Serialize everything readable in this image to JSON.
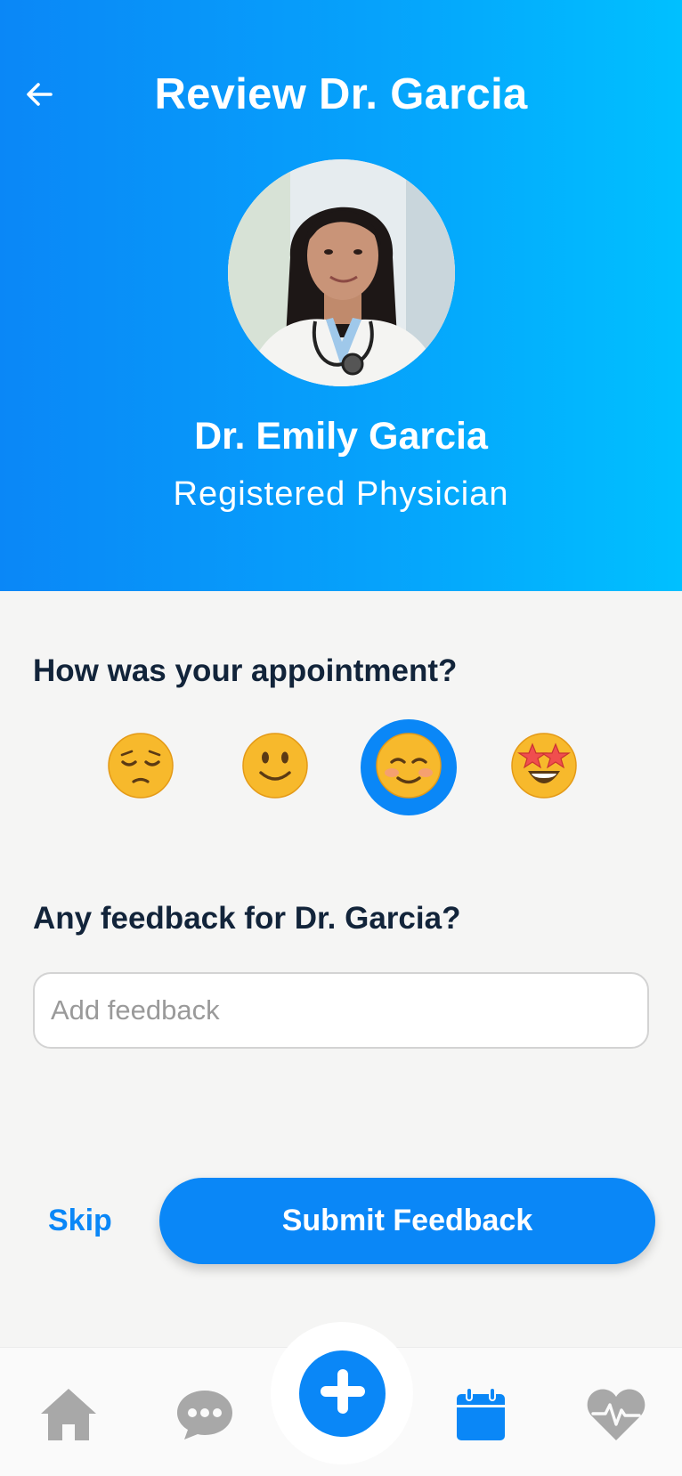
{
  "header": {
    "title": "Review Dr. Garcia",
    "back_icon": "arrow-left-icon"
  },
  "doctor": {
    "name": "Dr. Emily Garcia",
    "role": "Registered Physician"
  },
  "rating": {
    "question": "How was your appointment?",
    "options": [
      {
        "emoji": "😔",
        "icon": "pensive-face-icon",
        "selected": false
      },
      {
        "emoji": "🙂",
        "icon": "slightly-smiling-face-icon",
        "selected": false
      },
      {
        "emoji": "☺️",
        "icon": "smiling-face-icon",
        "selected": true
      },
      {
        "emoji": "🤩",
        "icon": "star-struck-face-icon",
        "selected": false
      }
    ]
  },
  "feedback": {
    "question": "Any feedback for Dr. Garcia?",
    "placeholder": "Add feedback",
    "value": ""
  },
  "actions": {
    "skip_label": "Skip",
    "submit_label": "Submit Feedback"
  },
  "nav": {
    "items": [
      "home-icon",
      "chat-icon",
      "add-icon",
      "calendar-icon",
      "heart-pulse-icon"
    ],
    "active": "calendar-icon"
  },
  "colors": {
    "primary": "#0a87f7",
    "header_gradient_end": "#00c0ff",
    "text_dark": "#12243a",
    "nav_inactive": "#a8a8a8"
  }
}
